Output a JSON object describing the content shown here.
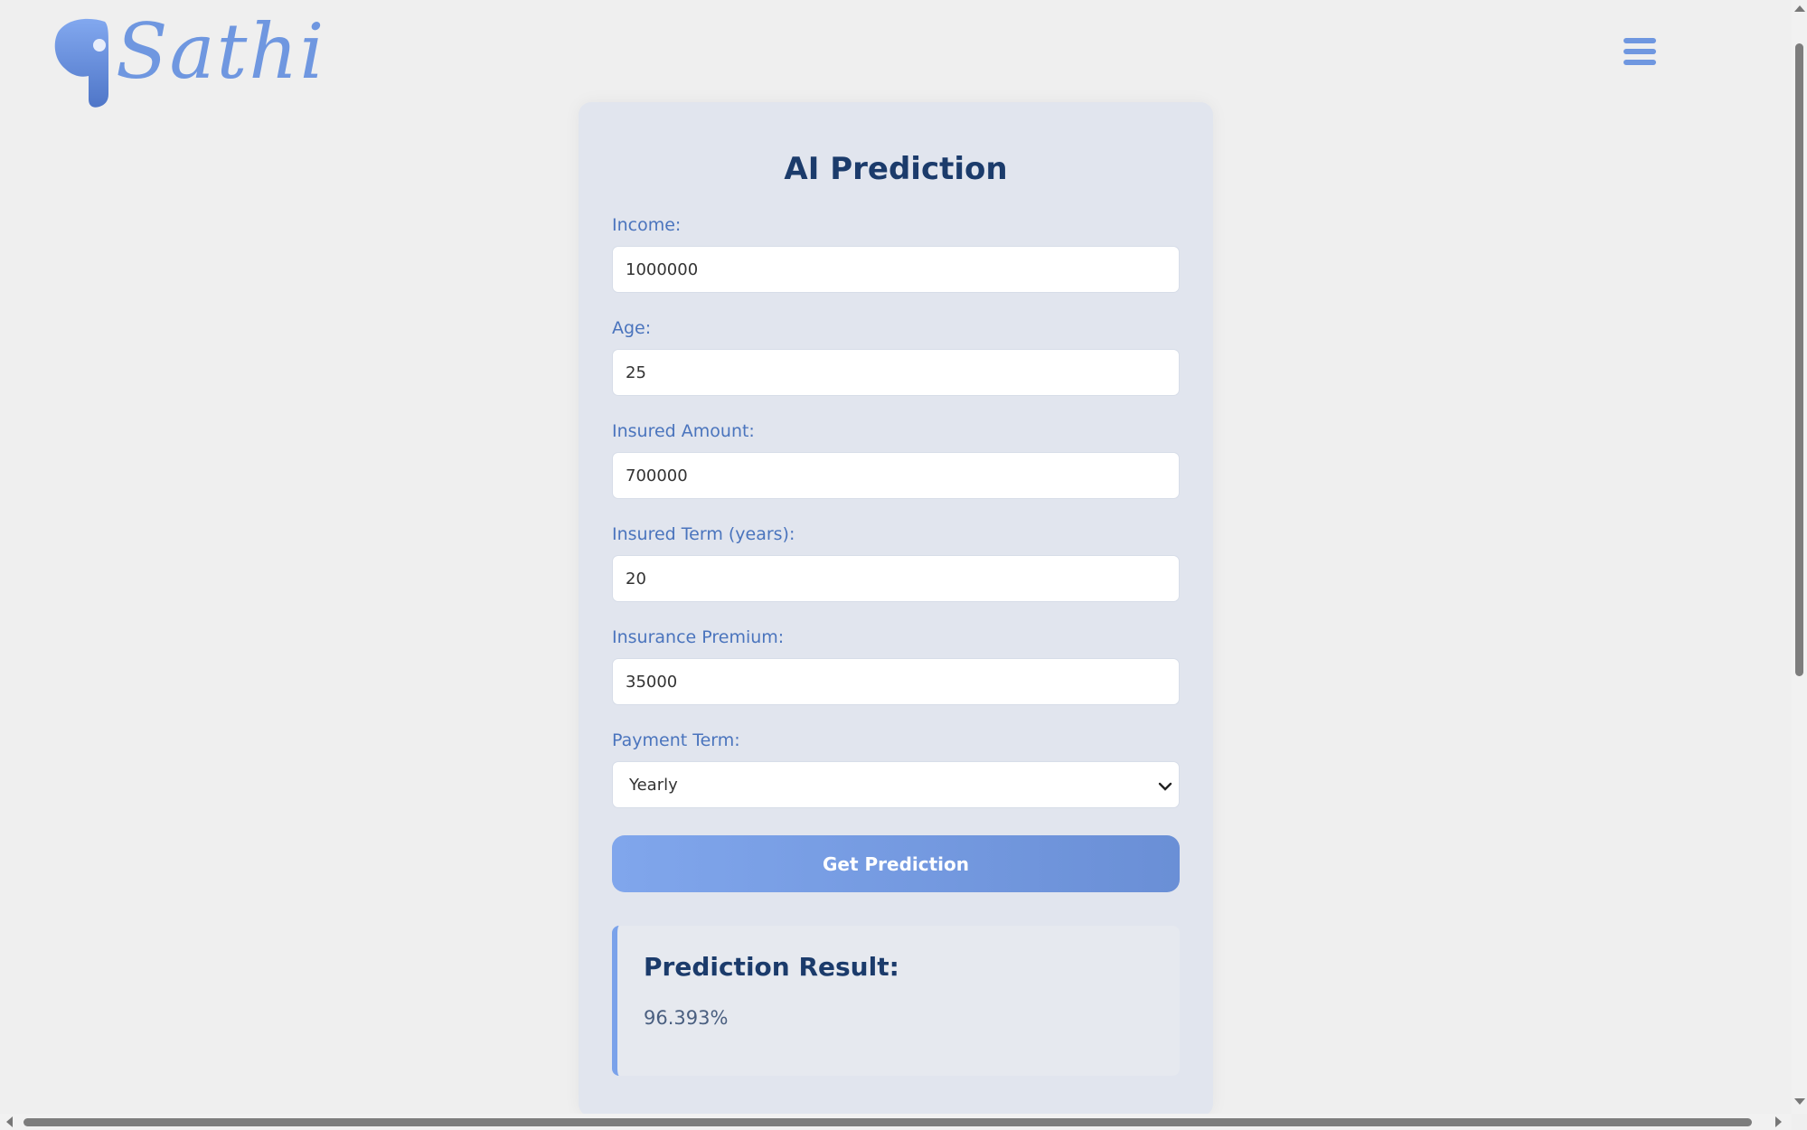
{
  "header": {
    "logo_text": "Sathi",
    "menu_icon": "hamburger-menu-icon"
  },
  "form": {
    "title": "AI Prediction",
    "fields": [
      {
        "label": "Income:",
        "value": "1000000"
      },
      {
        "label": "Age:",
        "value": "25"
      },
      {
        "label": "Insured Amount:",
        "value": "700000"
      },
      {
        "label": "Insured Term (years):",
        "value": "20"
      },
      {
        "label": "Insurance Premium:",
        "value": "35000"
      }
    ],
    "payment_term": {
      "label": "Payment Term:",
      "selected": "Yearly"
    },
    "submit_label": "Get Prediction"
  },
  "result": {
    "title": "Prediction Result:",
    "value": "96.393%"
  },
  "colors": {
    "accent": "#7aa2ea",
    "title": "#1b3b6b",
    "label": "#4a74bd",
    "card_bg": "#e1e5ee",
    "page_bg": "#efefef"
  }
}
